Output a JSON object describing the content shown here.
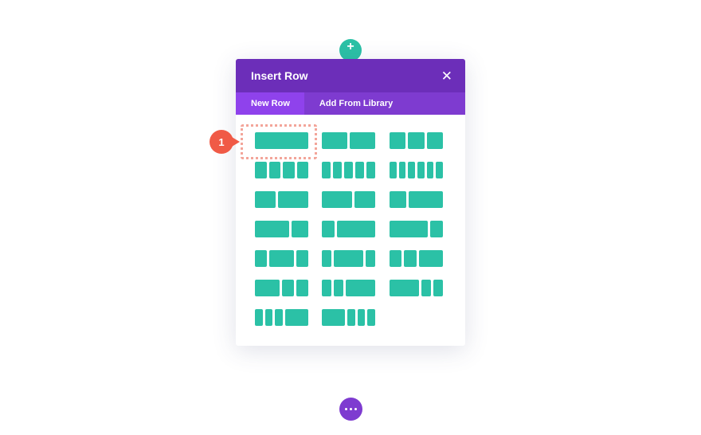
{
  "modal": {
    "title": "Insert Row",
    "close_icon": "close-icon",
    "tabs": [
      {
        "label": "New Row",
        "active": true
      },
      {
        "label": "Add From Library",
        "active": false
      }
    ]
  },
  "callout": {
    "number": "1"
  },
  "colors": {
    "header": "#6c2eb9",
    "tab_bar": "#7e3bd0",
    "tab_active": "#8f42ec",
    "column": "#2bc1a6",
    "callout": "#f05a46",
    "highlight": "#f3a59a",
    "more_button": "#7e3bd0"
  },
  "icons": {
    "add_row": "plus-icon",
    "more": "ellipsis-icon"
  },
  "layouts": [
    [
      1
    ],
    [
      1,
      1
    ],
    [
      1,
      1,
      1
    ],
    [
      1,
      1,
      1,
      1
    ],
    [
      1,
      1,
      1,
      1,
      1
    ],
    [
      1,
      1,
      1,
      1,
      1,
      1
    ],
    [
      2,
      3
    ],
    [
      3,
      2
    ],
    [
      1,
      2
    ],
    [
      2,
      1
    ],
    [
      1,
      3
    ],
    [
      3,
      1
    ],
    [
      1,
      2,
      1
    ],
    [
      1,
      3,
      1
    ],
    [
      1,
      1,
      2
    ],
    [
      2,
      1,
      1
    ],
    [
      1,
      1,
      3
    ],
    [
      3,
      1,
      1
    ],
    [
      1,
      1,
      1,
      3
    ],
    [
      3,
      1,
      1,
      1
    ]
  ]
}
